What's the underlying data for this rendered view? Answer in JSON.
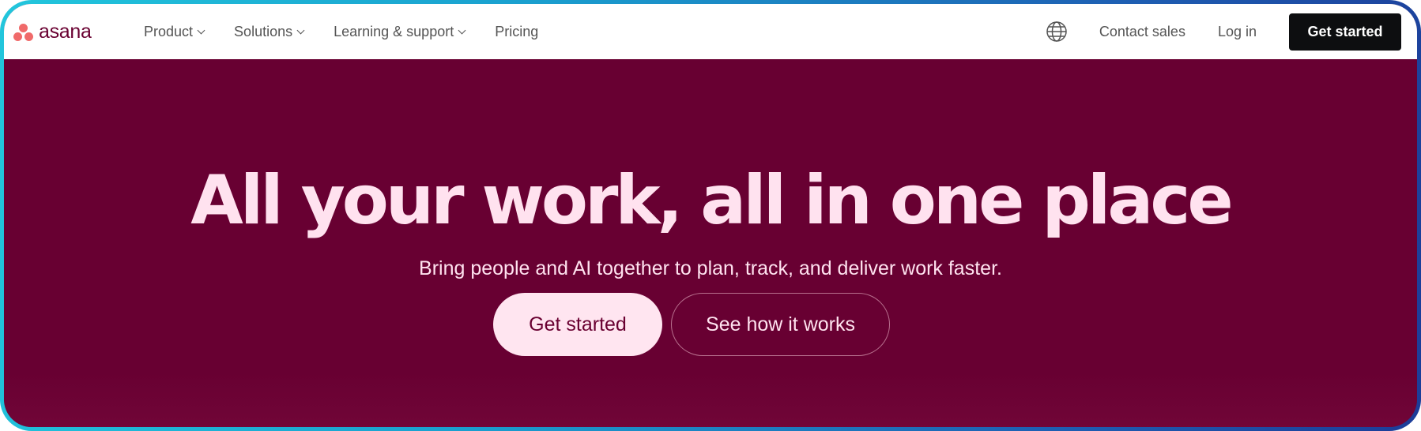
{
  "nav": {
    "logo_text": "asana",
    "links": [
      {
        "label": "Product",
        "has_dropdown": true
      },
      {
        "label": "Solutions",
        "has_dropdown": true
      },
      {
        "label": "Learning & support",
        "has_dropdown": true
      },
      {
        "label": "Pricing",
        "has_dropdown": false
      }
    ],
    "globe_icon": "globe-icon",
    "contact_sales": "Contact sales",
    "login": "Log in",
    "get_started": "Get started"
  },
  "hero": {
    "title": "All your work, all in one place",
    "subtitle": "Bring people and AI together to plan, track, and deliver work faster.",
    "primary_cta": "Get started",
    "secondary_cta": "See how it works"
  },
  "colors": {
    "hero_background": "#680032",
    "hero_text": "#ffe2ef",
    "logo_dots": "#f06a6a",
    "logo_text": "#690031",
    "dark_button": "#0d0e10",
    "frame_gradient_start": "#22c6dc",
    "frame_gradient_end": "#1c3c98"
  }
}
